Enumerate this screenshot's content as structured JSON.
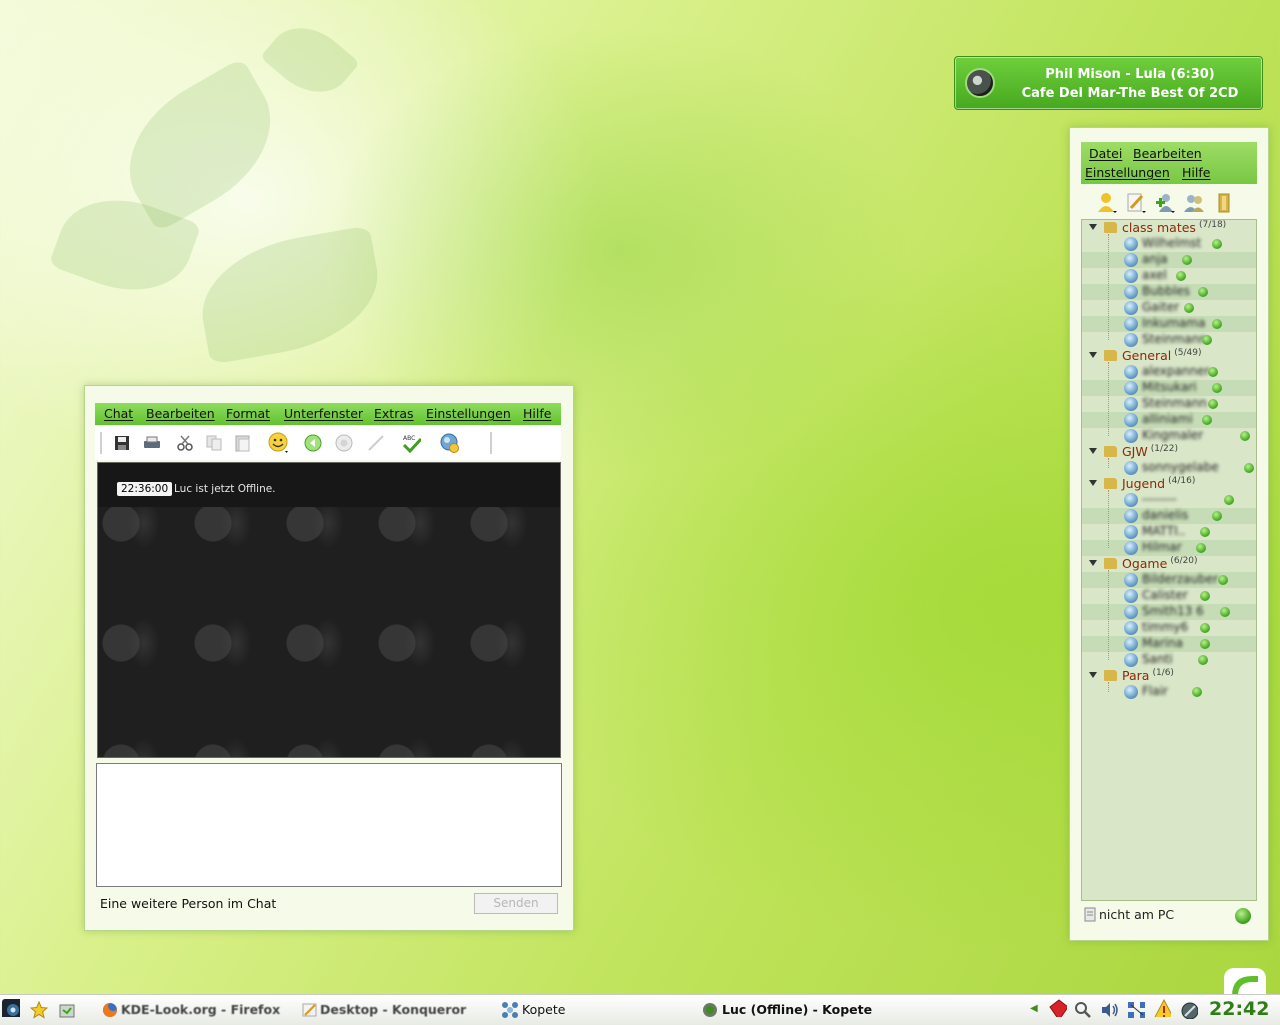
{
  "now_playing": {
    "line1": "Phil Mison - Lula (6:30)",
    "line2": "Cafe Del Mar-The Best Of 2CD"
  },
  "chat_window": {
    "menu": [
      "Chat",
      "Bearbeiten",
      "Format",
      "Unterfenster",
      "Extras",
      "Einstellungen",
      "Hilfe"
    ],
    "toolbar_icons": [
      "save-icon",
      "print-icon",
      "cut-icon",
      "copy-icon",
      "paste-icon",
      "emoticon-icon",
      "previous-icon",
      "next-icon",
      "pen-icon",
      "spellcheck-icon",
      "contact-info-icon"
    ],
    "messages": [
      {
        "time": "22:36:00",
        "text": "Luc ist jetzt Offline."
      }
    ],
    "status_text": "Eine weitere Person im Chat",
    "send_label": "Senden"
  },
  "contact_window": {
    "menu": [
      "Datei",
      "Bearbeiten",
      "Einstellungen",
      "Hilfe"
    ],
    "groups": [
      {
        "name": "class mates",
        "count": "(7/18)",
        "contacts": [
          "Wilhelmst",
          "anja",
          "axel",
          "Bubbles",
          "Gaiter",
          "Inkumama",
          "Steinmann"
        ]
      },
      {
        "name": "General",
        "count": "(5/49)",
        "contacts": [
          "alexpanner",
          "Mitsukari",
          "Steinmann",
          "alliniami",
          "Kingmaler"
        ]
      },
      {
        "name": "GJW",
        "count": "(1/22)",
        "contacts": [
          "sonnygelabe"
        ]
      },
      {
        "name": "Jugend",
        "count": "(4/16)",
        "contacts": [
          "--------",
          "danielis",
          "MATTI..",
          "Hilmar"
        ]
      },
      {
        "name": "Ogame",
        "count": "(6/20)",
        "contacts": [
          "Bilderzauber",
          "Calister",
          "Smith13 6",
          "timmy6",
          "Marina",
          "Santi"
        ]
      },
      {
        "name": "Para",
        "count": "(1/6)",
        "contacts": [
          "Flair"
        ]
      }
    ],
    "status": "nicht am PC"
  },
  "taskbar": {
    "tasks": [
      {
        "label": "KDE-Look.org - Firefox",
        "icon": "firefox-icon"
      },
      {
        "label": "Desktop - Konqueror",
        "icon": "konqueror-icon"
      },
      {
        "label": "Kopete",
        "icon": "kopete-icon"
      },
      {
        "label": "Luc (Offline) - Kopete",
        "icon": "kopete-chat-icon"
      }
    ],
    "clock": "22:42"
  }
}
